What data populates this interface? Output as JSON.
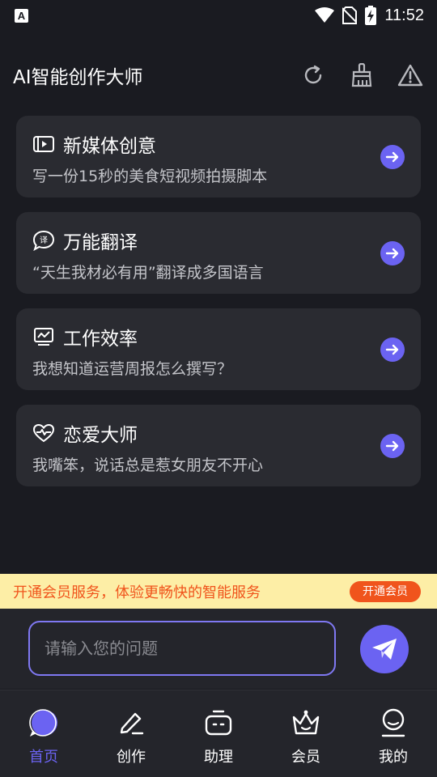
{
  "status_bar": {
    "notification_icon": "A",
    "time": "11:52",
    "icons": [
      "wifi-icon",
      "no-sim-icon",
      "battery-charging-icon"
    ]
  },
  "header": {
    "title": "AI智能创作大师",
    "actions": [
      "refresh-icon",
      "broom-icon",
      "warning-icon"
    ]
  },
  "cards": [
    {
      "icon": "video-icon",
      "title": "新媒体创意",
      "subtitle": "写一份15秒的美食短视频拍摄脚本"
    },
    {
      "icon": "translate-icon",
      "title": "万能翻译",
      "subtitle": "“天生我材必有用”翻译成多国语言"
    },
    {
      "icon": "chart-icon",
      "title": "工作效率",
      "subtitle": "我想知道运营周报怎么撰写？"
    },
    {
      "icon": "heart-pulse-icon",
      "title": "恋爱大师",
      "subtitle": "我嘴笨，说话总是惹女朋友不开心"
    }
  ],
  "promo": {
    "text": "开通会员服务，体验更畅快的智能服务",
    "button": "开通会员"
  },
  "input": {
    "value": "",
    "placeholder": "请输入您的问题"
  },
  "nav": {
    "items": [
      {
        "label": "首页",
        "icon": "chat-bubble-icon",
        "active": true
      },
      {
        "label": "创作",
        "icon": "pen-icon",
        "active": false
      },
      {
        "label": "助理",
        "icon": "robot-icon",
        "active": false
      },
      {
        "label": "会员",
        "icon": "crown-icon",
        "active": false
      },
      {
        "label": "我的",
        "icon": "user-icon",
        "active": false
      }
    ]
  },
  "colors": {
    "background": "#1a1b21",
    "card": "#2a2b31",
    "accent": "#6b63f2",
    "promo_bg": "#fdeea6",
    "promo_text": "#f0541c"
  }
}
